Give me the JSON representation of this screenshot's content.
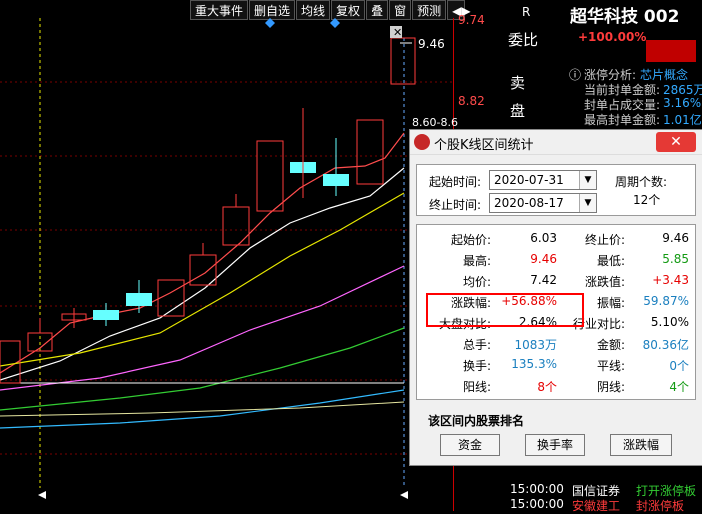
{
  "toolbar": {
    "items": [
      "重大事件",
      "删自选",
      "均线",
      "复权",
      "叠",
      "窗",
      "预测"
    ],
    "nav_icon": "◀▶"
  },
  "price_axis": {
    "labels": [
      "9.74",
      "9.46",
      "8.82",
      "8.60"
    ],
    "marker_label": "9.46",
    "partial_label": "8.60-8.6"
  },
  "quote": {
    "r_flag": "R",
    "stock_name": "超华科技 002",
    "weibi_label": "委比",
    "weibi_value": "+100.00%",
    "sell_label": "卖",
    "pan_label": "盘",
    "limit_analysis_label": "涨停分析:",
    "limit_analysis_value": "芯片概念",
    "seal_amount_label": "当前封单金额:",
    "seal_amount_value": "2865万",
    "seal_ratio_label": "封单占成交量:",
    "seal_ratio_value": "3.16%",
    "max_seal_label": "最高封单金额:",
    "max_seal_value": "1.01亿"
  },
  "dialog": {
    "title": "个股K线区间统计",
    "close_label": "✕",
    "start_label": "起始时间:",
    "start_value": "2020-07-31",
    "end_label": "终止时间:",
    "end_value": "2020-08-17",
    "period_label": "周期个数:",
    "period_value": "12个",
    "stats": [
      {
        "l1": "起始价:",
        "v1": "6.03",
        "c1": "blk",
        "l2": "终止价:",
        "v2": "9.46",
        "c2": "blk"
      },
      {
        "l1": "最高:",
        "v1": "9.46",
        "c1": "red",
        "l2": "最低:",
        "v2": "5.85",
        "c2": "green"
      },
      {
        "l1": "均价:",
        "v1": "7.42",
        "c1": "blk",
        "l2": "涨跌值:",
        "v2": "+3.43",
        "c2": "red"
      },
      {
        "l1": "涨跌幅:",
        "v1": "+56.88%",
        "c1": "red",
        "l2": "振幅:",
        "v2": "59.87%",
        "c2": "blue"
      },
      {
        "l1": "大盘对比:",
        "v1": "2.64%",
        "c1": "blk",
        "l2": "行业对比:",
        "v2": "5.10%",
        "c2": "blk"
      },
      {
        "l1": "总手:",
        "v1": "1083万",
        "c1": "blue",
        "l2": "金额:",
        "v2": "80.36亿",
        "c2": "blue"
      },
      {
        "l1": "换手:",
        "v1": "135.3%",
        "c1": "blue",
        "l2": "平线:",
        "v2": "0个",
        "c2": "blue"
      },
      {
        "l1": "阳线:",
        "v1": "8个",
        "c1": "red",
        "l2": "阴线:",
        "v2": "4个",
        "c2": "green"
      }
    ],
    "ranking_title": "该区间内股票排名",
    "buttons": [
      "资金",
      "换手率",
      "涨跌幅"
    ]
  },
  "trades": [
    {
      "time": "15:00:00",
      "broker": "国信证券",
      "action": "打开涨停板"
    },
    {
      "time": "15:00:00",
      "broker": "安徽建工",
      "action": "封涨停板"
    }
  ],
  "colors": {
    "up": "#ff3b3b",
    "down": "#00e6e6",
    "highlight_box": "#ff0000"
  },
  "icons": [
    "diamond-marker-icon",
    "close-marker-icon",
    "horizontal-arrows-icon",
    "dropdown-arrow-icon"
  ]
}
